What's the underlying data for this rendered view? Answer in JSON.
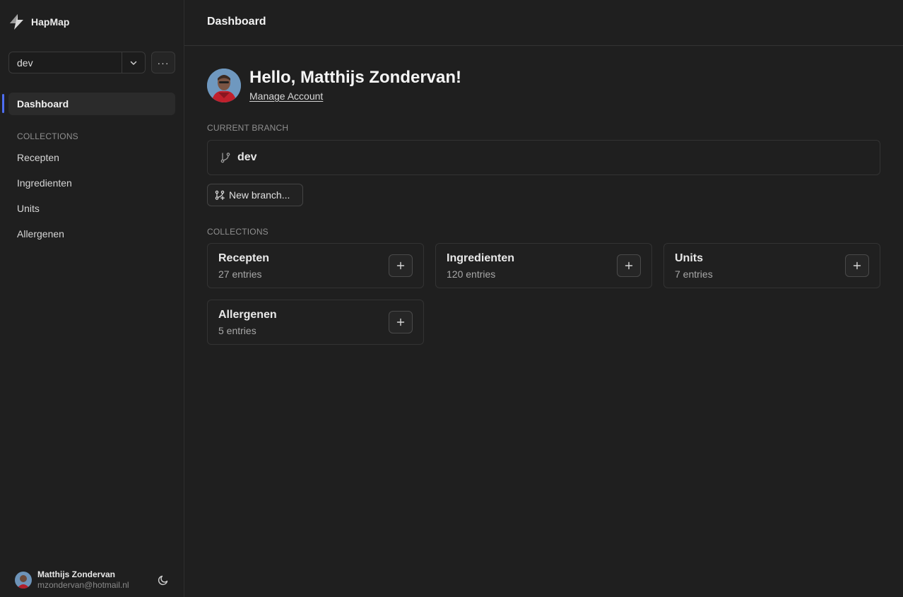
{
  "app": {
    "name": "HapMap"
  },
  "sidebar": {
    "branch_select_value": "dev",
    "more_label": "···",
    "dashboard_label": "Dashboard",
    "collections_heading": "COLLECTIONS",
    "items": [
      {
        "label": "Recepten"
      },
      {
        "label": "Ingredienten"
      },
      {
        "label": "Units"
      },
      {
        "label": "Allergenen"
      }
    ],
    "user": {
      "name": "Matthijs Zondervan",
      "email": "mzondervan@hotmail.nl"
    }
  },
  "header": {
    "title": "Dashboard"
  },
  "main": {
    "greeting": "Hello, Matthijs Zondervan!",
    "manage_account": "Manage Account",
    "current_branch_heading": "CURRENT BRANCH",
    "current_branch": "dev",
    "new_branch_label": "New branch...",
    "collections_heading": "COLLECTIONS",
    "collections": [
      {
        "title": "Recepten",
        "count": "27 entries"
      },
      {
        "title": "Ingredienten",
        "count": "120 entries"
      },
      {
        "title": "Units",
        "count": "7 entries"
      },
      {
        "title": "Allergenen",
        "count": "5 entries"
      }
    ]
  },
  "icons": {
    "logo": "lightning-logo-icon",
    "select_caret": "chevron-down-icon",
    "branch": "git-branch-icon",
    "new_branch": "git-branch-plus-icon",
    "add": "plus-icon",
    "theme": "moon-icon"
  },
  "colors": {
    "accent": "#4e6ef2",
    "background": "#1f1f1f",
    "border": "#333333"
  }
}
